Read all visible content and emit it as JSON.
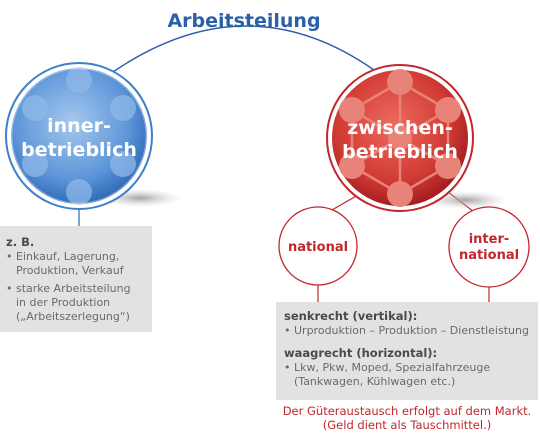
{
  "title": "Arbeitsteilung",
  "left_node": {
    "line1": "inner-",
    "line2": "betrieblich"
  },
  "right_node": {
    "line1": "zwischen-",
    "line2": "betrieblich"
  },
  "national": "national",
  "international": {
    "line1": "inter-",
    "line2": "national"
  },
  "left_box": {
    "heading": "z. B.",
    "bullet": "•",
    "items": [
      [
        "Einkauf, Lagerung,",
        "Produktion, Verkauf"
      ],
      [
        "starke Arbeitsteilung",
        "in der Produktion",
        "(„Arbeitszerlegung“)"
      ]
    ]
  },
  "right_box": {
    "heading1": "senkrecht (vertikal):",
    "item1": "Urproduktion – Produktion – Dienstleistung",
    "heading2": "waagrecht (horizontal):",
    "item2": [
      "Lkw, Pkw, Moped, Spezialfahrzeuge",
      "(Tankwagen, Kühlwagen etc.)"
    ]
  },
  "footnote": [
    "Der Güteraustausch erfolgt auf dem Markt.",
    "(Geld dient als Tauschmittel.)"
  ],
  "colors": {
    "blue": "#3f7fca",
    "blue_light": "#8fb8e8",
    "red": "#c1272d",
    "red_light": "#e8837a",
    "title_blue": "#2b5fa6",
    "box_gray": "#e2e2e2"
  }
}
